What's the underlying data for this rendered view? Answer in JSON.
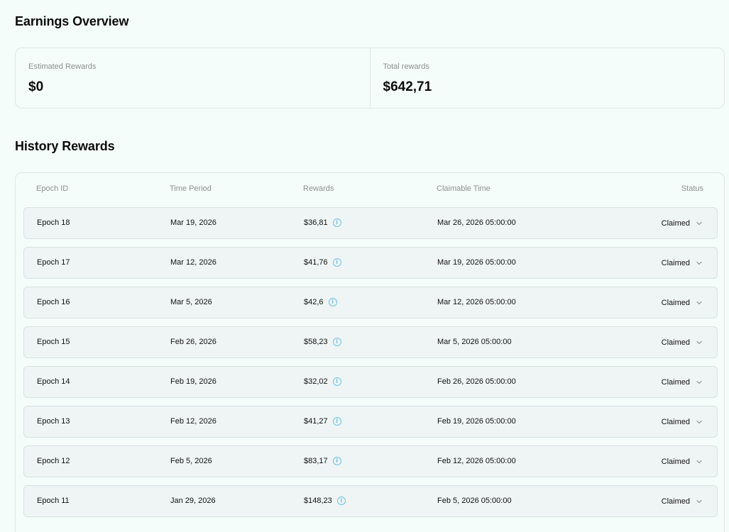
{
  "overview": {
    "title": "Earnings Overview",
    "estimated_label": "Estimated Rewards",
    "estimated_value": "$0",
    "total_label": "Total rewards",
    "total_value": "$642,71"
  },
  "history": {
    "title": "History Rewards",
    "columns": [
      "Epoch ID",
      "Time Period",
      "Rewards",
      "Claimable Time",
      "Status"
    ],
    "rows": [
      {
        "epoch": "Epoch 18",
        "period": "Mar 19, 2026",
        "reward": "$36,81",
        "claimable": "Mar 26, 2026 05:00:00",
        "status": "Claimed"
      },
      {
        "epoch": "Epoch 17",
        "period": "Mar 12, 2026",
        "reward": "$41,76",
        "claimable": "Mar 19, 2026 05:00:00",
        "status": "Claimed"
      },
      {
        "epoch": "Epoch 16",
        "period": "Mar 5, 2026",
        "reward": "$42,6",
        "claimable": "Mar 12, 2026 05:00:00",
        "status": "Claimed"
      },
      {
        "epoch": "Epoch 15",
        "period": "Feb 26, 2026",
        "reward": "$58,23",
        "claimable": "Mar 5, 2026 05:00:00",
        "status": "Claimed"
      },
      {
        "epoch": "Epoch 14",
        "period": "Feb 19, 2026",
        "reward": "$32,02",
        "claimable": "Feb 26, 2026 05:00:00",
        "status": "Claimed"
      },
      {
        "epoch": "Epoch 13",
        "period": "Feb 12, 2026",
        "reward": "$41,27",
        "claimable": "Feb 19, 2026 05:00:00",
        "status": "Claimed"
      },
      {
        "epoch": "Epoch 12",
        "period": "Feb 5, 2026",
        "reward": "$83,17",
        "claimable": "Feb 12, 2026 05:00:00",
        "status": "Claimed"
      },
      {
        "epoch": "Epoch 11",
        "period": "Jan 29, 2026",
        "reward": "$148,23",
        "claimable": "Feb 5, 2026 05:00:00",
        "status": "Claimed"
      }
    ]
  },
  "icons": {
    "info": "info-circle-icon",
    "expand": "chevron-down-icon"
  },
  "colors": {
    "background": "#f5fdfb",
    "row_bg": "#eef5f4",
    "info_accent": "#6fc2e6"
  }
}
